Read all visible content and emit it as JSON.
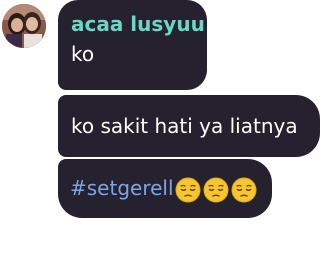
{
  "thread": {
    "messages": [
      {
        "sender": "acaa lusyuu",
        "text": "ko"
      },
      {
        "text": "ko sakit hati ya liatnya"
      },
      {
        "hashtag": "#setgerell",
        "emojis": [
          "pensive-face",
          "pensive-face",
          "pensive-face"
        ]
      }
    ]
  },
  "colors": {
    "bubble": "#25212e",
    "sender": "#6ad7c4",
    "hashtag": "#7aa6e8",
    "text": "#ffffff"
  }
}
